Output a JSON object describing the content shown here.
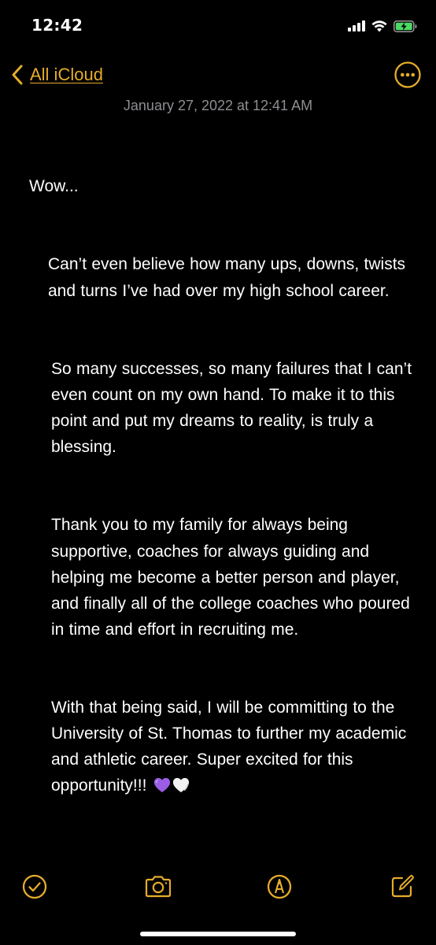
{
  "status_bar": {
    "time": "12:42",
    "icons": [
      "cellular-signal-icon",
      "wifi-icon",
      "battery-charging-icon"
    ],
    "battery_color": "#4cd964"
  },
  "nav": {
    "back_label": "All iCloud",
    "back_icon": "chevron-left-icon",
    "more_icon": "ellipsis-circle-icon",
    "accent_color": "#e5ac2b"
  },
  "note": {
    "date": "January 27, 2022 at 12:41 AM",
    "paragraphs": [
      "Wow...",
      "Can’t even believe how many ups, downs, twists and turns I’ve had over my high school career.",
      "So many successes, so many failures that I can’t even count on my own hand. To make it to this point and put my dreams to reality, is truly a blessing.",
      "Thank you to my family for always being supportive, coaches for always guiding and helping me become a better person and player, and finally all of the college coaches who poured in time and effort in recruiting me.",
      "With that being said, I will be committing to the University of St. Thomas to further my academic and athletic career. Super excited for this opportunity!!!"
    ],
    "emojis": [
      "purple-heart",
      "white-heart"
    ]
  },
  "toolbar": {
    "items": [
      "checklist-icon",
      "camera-icon",
      "markup-pen-icon",
      "compose-icon"
    ]
  }
}
